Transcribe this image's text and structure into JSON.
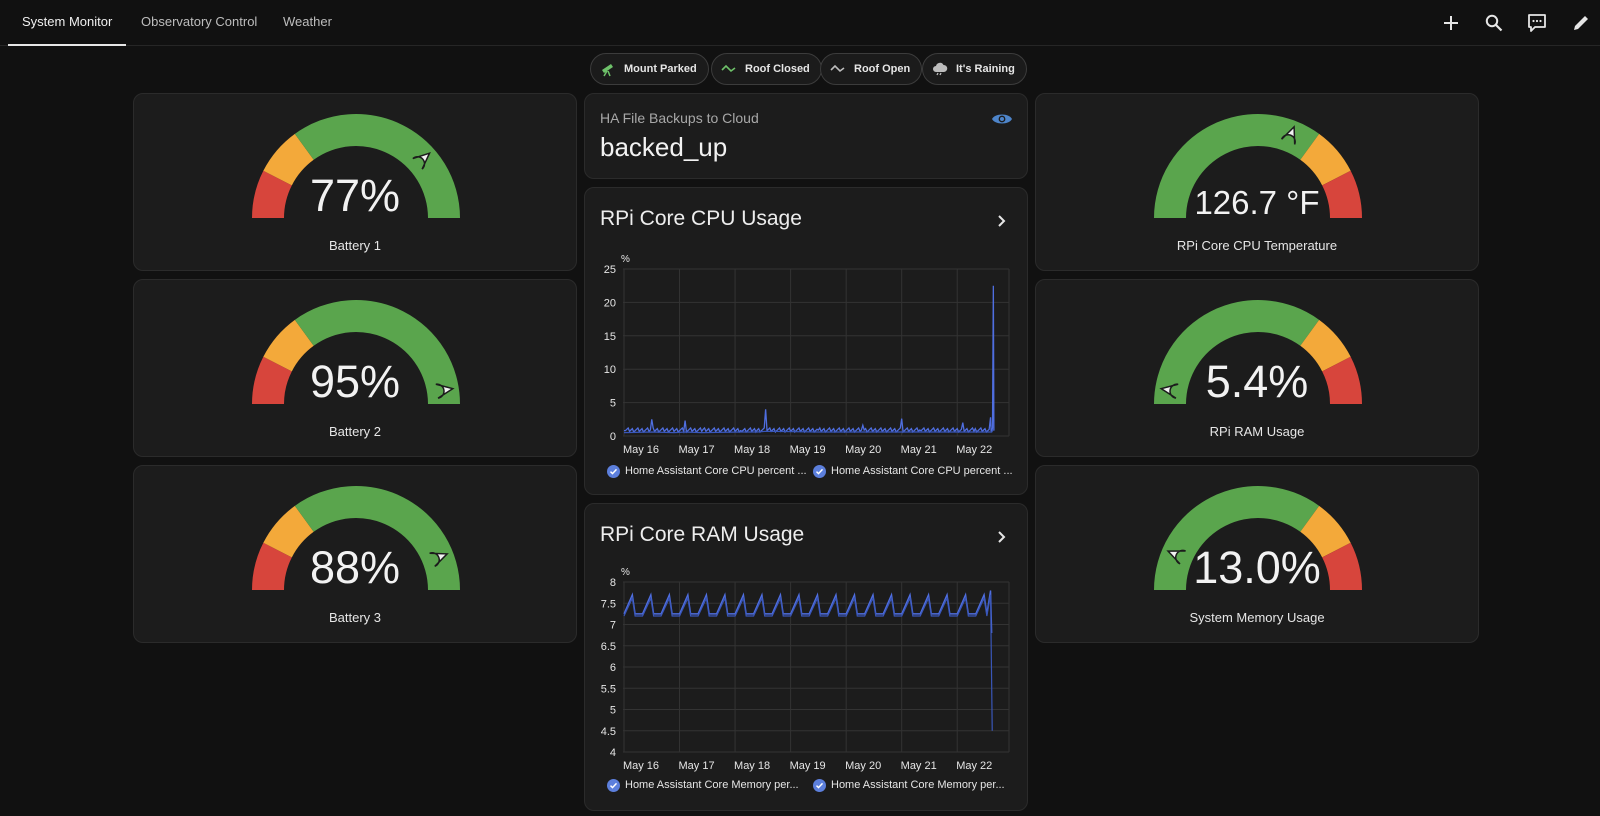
{
  "tabs": [
    {
      "label": "System Monitor",
      "active": true
    },
    {
      "label": "Observatory Control",
      "active": false
    },
    {
      "label": "Weather",
      "active": false
    }
  ],
  "toolbar_icons": [
    "plus-icon",
    "search-icon",
    "assist-chat-icon",
    "pencil-icon"
  ],
  "chips": [
    {
      "label": "Mount Parked",
      "icon": "telescope-icon",
      "icon_color": "#6ec26a"
    },
    {
      "label": "Roof Closed",
      "icon": "roof-closed-icon",
      "icon_color": "#6ec26a"
    },
    {
      "label": "Roof Open",
      "icon": "roof-open-icon",
      "icon_color": "#bdbdbd"
    },
    {
      "label": "It's Raining",
      "icon": "cloud-rain-icon",
      "icon_color": "#bdbdbd"
    }
  ],
  "gauges": {
    "battery1": {
      "value": "77%",
      "name": "Battery 1",
      "fraction": 0.77
    },
    "battery2": {
      "value": "95%",
      "name": "Battery 2",
      "fraction": 0.95
    },
    "battery3": {
      "value": "88%",
      "name": "Battery 3",
      "fraction": 0.88
    },
    "cpu_temp": {
      "value": "126.7 °F",
      "name": "RPi Core CPU Temperature",
      "fraction": 0.62
    },
    "ram": {
      "value": "5.4%",
      "name": "RPi RAM Usage",
      "fraction": 0.05
    },
    "sys_mem": {
      "value": "13.0%",
      "name": "System Memory Usage",
      "fraction": 0.13
    }
  },
  "severity_colors": {
    "red": "#d7453c",
    "orange": "#f3a93a",
    "green": "#5aa54d"
  },
  "backup": {
    "name": "HA File Backups to Cloud",
    "state": "backed_up",
    "icon": "eye-icon"
  },
  "cpu_graph": {
    "title": "RPi Core CPU Usage",
    "icon": "chevron-right-icon"
  },
  "ram_graph": {
    "title": "RPi Core RAM Usage",
    "icon": "chevron-right-icon"
  },
  "legend": {
    "cpu": [
      "Home Assistant Core CPU percent ...",
      "Home Assistant Core CPU percent ..."
    ],
    "ram": [
      "Home Assistant Core Memory per...",
      "Home Assistant Core Memory per..."
    ]
  },
  "chart_data": [
    {
      "type": "line",
      "title": "RPi Core CPU Usage",
      "ylabel": "%",
      "ylim": [
        0,
        25
      ],
      "yticks": [
        0,
        5,
        10,
        15,
        20,
        25
      ],
      "xticks": [
        "May 16",
        "May 17",
        "May 18",
        "May 19",
        "May 20",
        "May 21",
        "May 22"
      ],
      "x_days": [
        0,
        0.5,
        0.9,
        1.1,
        1.4,
        2.1,
        2.4,
        2.55,
        3.5,
        4.3,
        5.0,
        5.35,
        6.1,
        6.3,
        6.6,
        6.62,
        6.65
      ],
      "series": [
        {
          "name": "Home Assistant Core CPU percent ...",
          "values": [
            0.8,
            2.5,
            0.7,
            2.3,
            0.7,
            0.8,
            0.9,
            4.0,
            0.9,
            1.6,
            2.6,
            0.8,
            2.0,
            0.7,
            2.8,
            0.7,
            22.5
          ]
        },
        {
          "name": "Home Assistant Core CPU percent ...",
          "values": [
            0.5,
            0.6,
            0.5,
            0.6,
            0.5,
            0.6,
            0.6,
            0.7,
            0.6,
            0.6,
            0.6,
            0.6,
            0.6,
            0.6,
            0.6,
            0.6,
            1.0
          ]
        }
      ],
      "grid": true,
      "legend_position": "bottom"
    },
    {
      "type": "line",
      "title": "RPi Core RAM Usage",
      "ylabel": "%",
      "ylim": [
        4,
        8
      ],
      "yticks": [
        4,
        4.5,
        5,
        5.5,
        6,
        6.5,
        7,
        7.5,
        8
      ],
      "xticks": [
        "May 16",
        "May 17",
        "May 18",
        "May 19",
        "May 20",
        "May 21",
        "May 22"
      ],
      "daily_cycle": {
        "low": 7.25,
        "high": 7.7,
        "cycles_per_day": 3
      },
      "drop_end": [
        6.8,
        4.5
      ],
      "series": [
        {
          "name": "Home Assistant Core Memory per..."
        },
        {
          "name": "Home Assistant Core Memory per..."
        }
      ],
      "grid": true,
      "legend_position": "bottom"
    }
  ]
}
